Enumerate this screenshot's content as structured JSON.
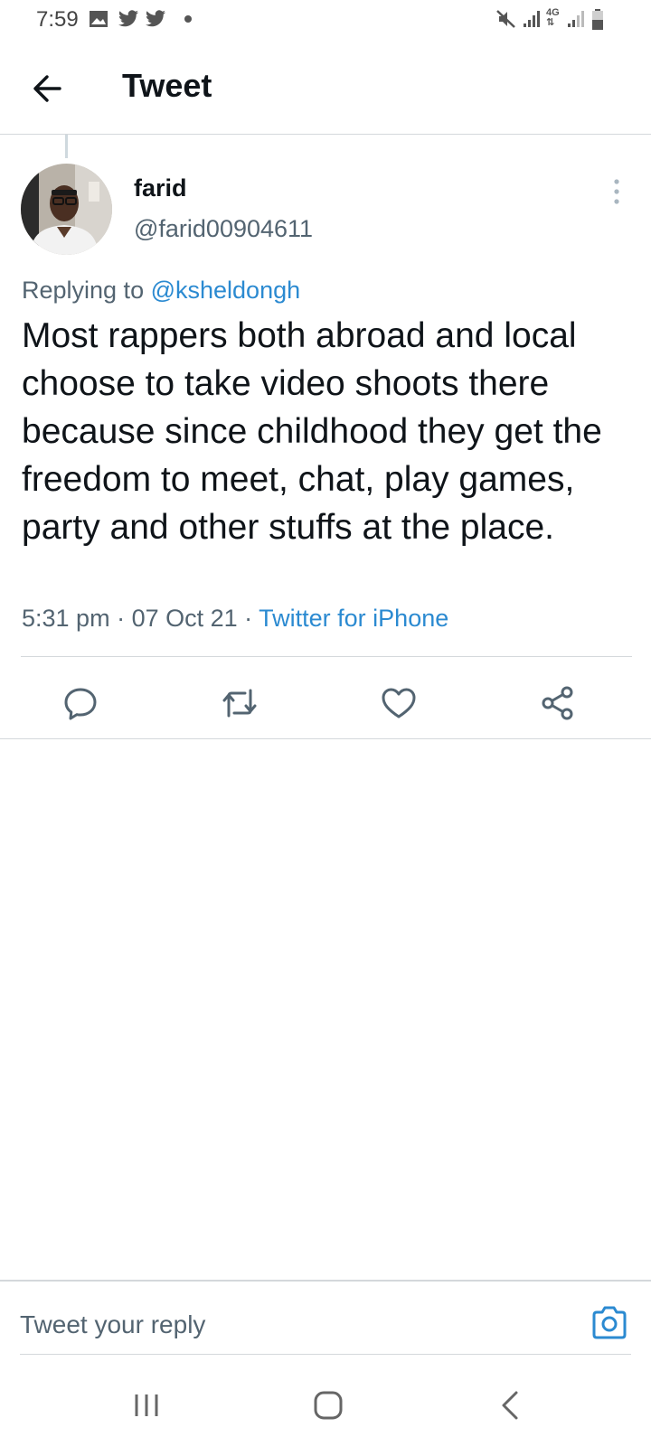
{
  "status_bar": {
    "time": "7:59",
    "network_label": "4G",
    "icons": [
      "gallery-icon",
      "twitter-icon",
      "twitter-icon",
      "dot-icon",
      "mute-icon",
      "signal-icon",
      "network-4g-icon",
      "signal-icon",
      "battery-icon"
    ]
  },
  "header": {
    "title": "Tweet"
  },
  "tweet": {
    "display_name": "farid",
    "handle": "@farid00904611",
    "replying_prefix": "Replying to ",
    "replying_to": "@ksheldongh",
    "text": "Most rappers both abroad and local choose to take video shoots there because since childhood they get the freedom to meet, chat, play games, party and other stuffs at the place.",
    "time": "5:31 pm",
    "separator": " · ",
    "date": "07 Oct 21",
    "source": "Twitter for iPhone"
  },
  "actions": [
    "reply-icon",
    "retweet-icon",
    "like-icon",
    "share-icon"
  ],
  "composer": {
    "placeholder": "Tweet your reply"
  },
  "colors": {
    "link": "#2b8ad1",
    "secondary_text": "#536471",
    "divider": "#d4d8db",
    "icon": "#536471"
  }
}
